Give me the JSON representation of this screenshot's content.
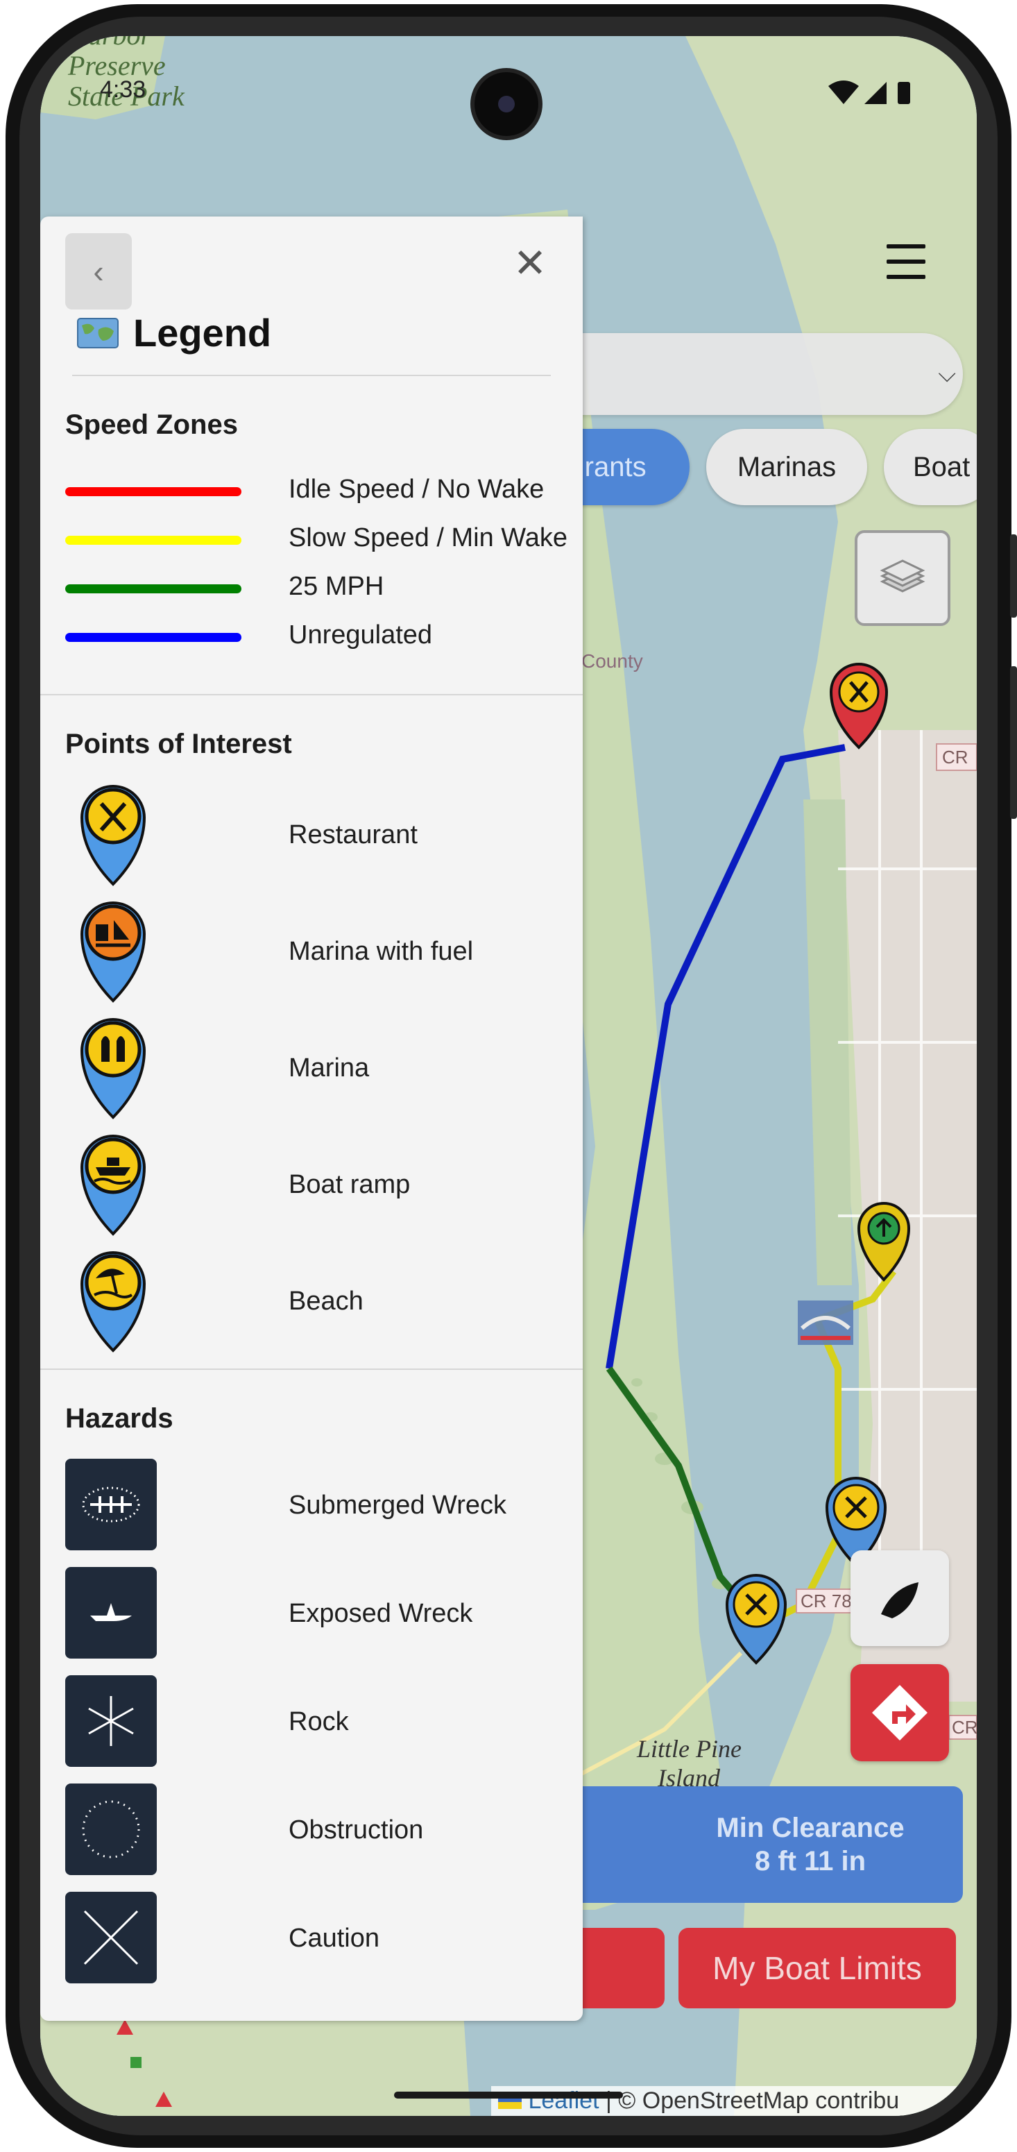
{
  "status_bar": {
    "time": "4:33"
  },
  "map": {
    "place_labels": [
      {
        "text": "Harbor"
      },
      {
        "text": "Preserve"
      },
      {
        "text": "State Park"
      },
      {
        "text": "County"
      },
      {
        "text": "CR"
      },
      {
        "text": "Little Pine"
      },
      {
        "text": "Island"
      },
      {
        "text": "CR 78"
      },
      {
        "text": "CR"
      }
    ],
    "filter_chips": [
      "urants",
      "Marinas",
      "Boat"
    ],
    "active_chip_index": 0,
    "min_clearance": {
      "label": "Min Clearance",
      "value": "8 ft 11 in"
    },
    "my_boat_limits": "My Boat Limits",
    "attribution": {
      "leaflet": "Leaflet",
      "sep": " | © ",
      "osm": "OpenStreetMap contribu"
    },
    "route_colors": {
      "unregulated": "#0a1cbf",
      "mph25": "#1e6b1e",
      "slow": "#d6d11a"
    }
  },
  "legend": {
    "title": "Legend",
    "back_label": "‹",
    "close_label": "✕",
    "speed_zones": {
      "title": "Speed Zones",
      "items": [
        {
          "label": "Idle Speed / No Wake",
          "color": "#ff0000"
        },
        {
          "label": "Slow Speed / Min Wake",
          "color": "#ffff00"
        },
        {
          "label": "25 MPH",
          "color": "#008000"
        },
        {
          "label": "Unregulated",
          "color": "#0000ff"
        }
      ]
    },
    "poi": {
      "title": "Points of Interest",
      "items": [
        {
          "label": "Restaurant",
          "icon": "restaurant-icon"
        },
        {
          "label": "Marina with fuel",
          "icon": "marina-fuel-icon"
        },
        {
          "label": "Marina",
          "icon": "marina-icon"
        },
        {
          "label": "Boat ramp",
          "icon": "boat-ramp-icon"
        },
        {
          "label": "Beach",
          "icon": "beach-icon"
        }
      ]
    },
    "hazards": {
      "title": "Hazards",
      "items": [
        {
          "label": "Submerged Wreck",
          "icon": "submerged-wreck-icon"
        },
        {
          "label": "Exposed Wreck",
          "icon": "exposed-wreck-icon"
        },
        {
          "label": "Rock",
          "icon": "rock-icon"
        },
        {
          "label": "Obstruction",
          "icon": "obstruction-icon"
        },
        {
          "label": "Caution",
          "icon": "caution-icon"
        }
      ]
    }
  }
}
